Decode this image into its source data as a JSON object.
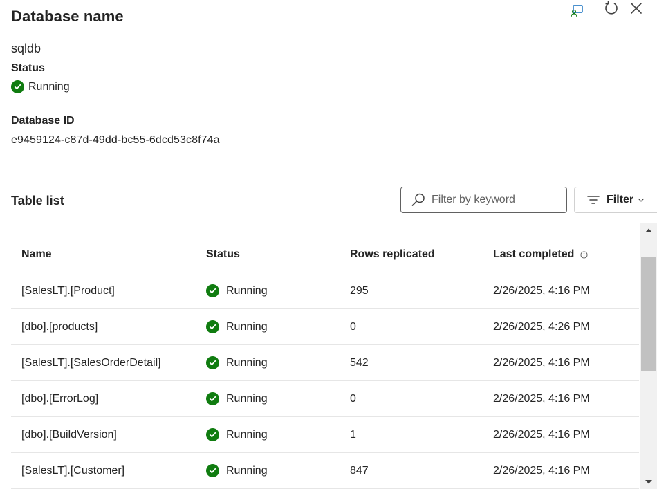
{
  "panel": {
    "title": "Database name",
    "database_name": "sqldb",
    "status_label": "Status",
    "status_value": "Running",
    "database_id_label": "Database ID",
    "database_id": "e9459124-c87d-49dd-bc55-6dcd53c8f74a"
  },
  "toolbar_icons": [
    "feedback-icon",
    "refresh-icon",
    "close-icon"
  ],
  "table_list": {
    "title": "Table list",
    "search_placeholder": "Filter by keyword",
    "filter_label": "Filter",
    "columns": {
      "name": "Name",
      "status": "Status",
      "rows": "Rows replicated",
      "last": "Last completed"
    },
    "rows": [
      {
        "name": "[SalesLT].[Product]",
        "status": "Running",
        "rows": "295",
        "last": "2/26/2025, 4:16 PM"
      },
      {
        "name": "[dbo].[products]",
        "status": "Running",
        "rows": "0",
        "last": "2/26/2025, 4:26 PM"
      },
      {
        "name": "[SalesLT].[SalesOrderDetail]",
        "status": "Running",
        "rows": "542",
        "last": "2/26/2025, 4:16 PM"
      },
      {
        "name": "[dbo].[ErrorLog]",
        "status": "Running",
        "rows": "0",
        "last": "2/26/2025, 4:16 PM"
      },
      {
        "name": "[dbo].[BuildVersion]",
        "status": "Running",
        "rows": "1",
        "last": "2/26/2025, 4:16 PM"
      },
      {
        "name": "[SalesLT].[Customer]",
        "status": "Running",
        "rows": "847",
        "last": "2/26/2025, 4:16 PM"
      }
    ]
  },
  "colors": {
    "success": "#107c10",
    "text": "#242424",
    "accent": "#0f6cbd"
  }
}
